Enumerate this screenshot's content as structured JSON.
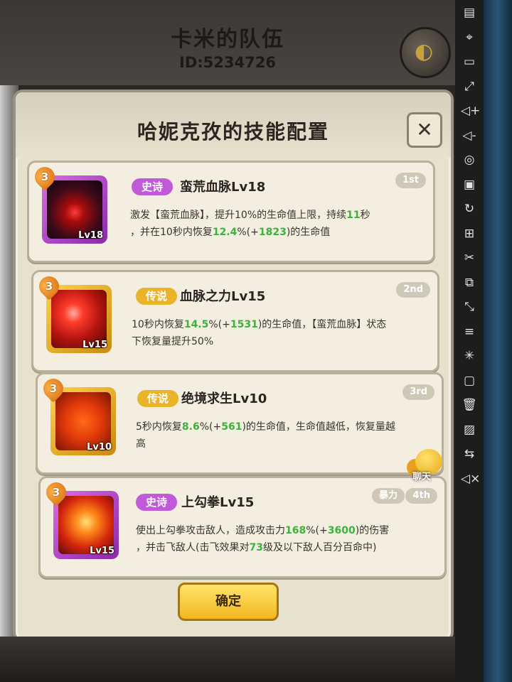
{
  "team": {
    "title": "卡米的队伍",
    "id": "ID:5234726"
  },
  "dialog": {
    "title": "哈妮克孜的技能配置",
    "close_label": "✕",
    "confirm_label": "确定"
  },
  "skills": [
    {
      "badge": "3",
      "rarity": "史诗",
      "name": "蛮荒血脉Lv18",
      "rank": "1st",
      "icon_level": "Lv18",
      "desc_line1": [
        "激发【蛮荒血脉】，提升10%的生命值上限，持续",
        "11",
        "秒"
      ],
      "desc_line2": [
        "，并在10秒内恢复",
        "12.4",
        "%(+",
        "1823",
        ")的生命值"
      ]
    },
    {
      "badge": "3",
      "rarity": "传说",
      "name": "血脉之力Lv15",
      "rank": "2nd",
      "icon_level": "Lv15",
      "desc_line1": [
        "10秒内恢复",
        "14.5",
        "%(+",
        "1531",
        ")的生命值，【蛮荒血脉】状态"
      ],
      "desc_line2": [
        "下恢复量提升50%"
      ]
    },
    {
      "badge": "3",
      "rarity": "传说",
      "name": "绝境求生Lv10",
      "rank": "3rd",
      "icon_level": "Lv10",
      "desc_line1": [
        "5秒内恢复",
        "8.6",
        "%(+",
        "561",
        ")的生命值，生命值越低，恢复量越"
      ],
      "desc_line2": [
        "高"
      ]
    },
    {
      "badge": "3",
      "rarity": "史诗",
      "name": "上勾拳Lv15",
      "rank": "4th",
      "extra_tag": "暴力",
      "icon_level": "Lv15",
      "desc_line1": [
        "使出上勾拳攻击敌人，造成攻击力",
        "168",
        "%(+",
        "3600",
        ")的伤害"
      ],
      "desc_line2": [
        "，并击飞敌人(击飞效果对",
        "73",
        "级及以下敌人百分百命中)"
      ]
    }
  ],
  "chat": {
    "label": "聊天"
  },
  "colors": {
    "epic": "#c05ad8",
    "legend": "#e9b32a",
    "highlight": "#3bb33b"
  },
  "side_icons": [
    "calendar-icon",
    "location-icon",
    "display-icon",
    "fullscreen-icon",
    "volume-up-icon",
    "volume-down-icon",
    "screenshot-icon",
    "layers-icon",
    "refresh-icon",
    "add-icon",
    "scissors-icon",
    "copy-icon",
    "resize-icon",
    "menu-icon",
    "loading-icon",
    "video-icon",
    "trash-icon",
    "image-icon",
    "swap-icon",
    "mute-icon"
  ]
}
